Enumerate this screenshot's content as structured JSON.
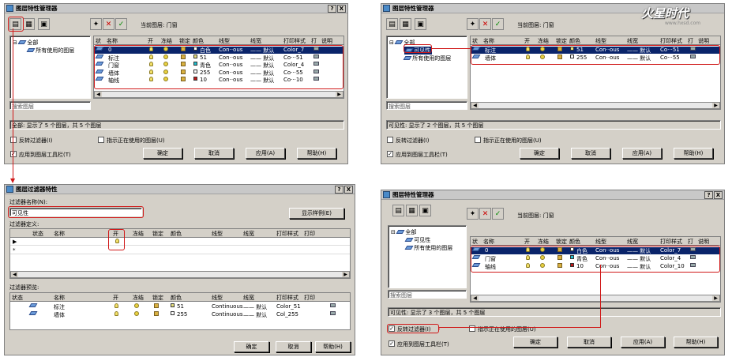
{
  "common": {
    "title": "图层特性管理器",
    "help_btn": "?",
    "close_btn": "X",
    "all_node": "全部",
    "used_node": "所有使用的图层",
    "search_placeholder": "搜索图层",
    "invert_filter": "反转过滤器(I)",
    "indicate_used": "指示正在使用的图层(U)",
    "apply_toolbar": "应用到图层工具栏(T)",
    "ok": "确定",
    "cancel": "取消",
    "apply": "应用(A)",
    "help": "帮助(H)",
    "columns": [
      "状",
      "名称",
      "开",
      "冻结",
      "锁定",
      "颜色",
      "线型",
      "线宽",
      "打印样式",
      "打",
      "说明"
    ]
  },
  "dialog1": {
    "current_layer": "当前图层: 门窗",
    "status": "全部: 显示了 5 个图层，共 5 个图层",
    "rows": [
      {
        "name": "0",
        "color_name": "白色",
        "color": "#ffffff",
        "linetype": "Con··ous",
        "lineweight": "—— 默认",
        "plot": "Color_7"
      },
      {
        "name": "标注",
        "color_name": "51",
        "color": "#e8e080",
        "linetype": "Con··ous",
        "lineweight": "—— 默认",
        "plot": "Co···51"
      },
      {
        "name": "门窗",
        "color_name": "青色",
        "color": "#20c0d0",
        "linetype": "Con··ous",
        "lineweight": "—— 默认",
        "plot": "Color_4"
      },
      {
        "name": "墙体",
        "color_name": "255",
        "color": "#ffffff",
        "linetype": "Con··ous",
        "lineweight": "—— 默认",
        "plot": "Co···55"
      },
      {
        "name": "轴线",
        "color_name": "10",
        "color": "#c01818",
        "linetype": "Con··ous",
        "lineweight": "—— 默认",
        "plot": "Co···10"
      }
    ]
  },
  "dialog2": {
    "current_layer": "当前图层: 门窗",
    "filter_node": "可见性",
    "status": "可见性: 显示了 2 个图层，共 5 个图层",
    "rows": [
      {
        "name": "标注",
        "color_name": "51",
        "color": "#e8e080",
        "linetype": "Con··ous",
        "lineweight": "—— 默认",
        "plot": "Co···51"
      },
      {
        "name": "墙体",
        "color_name": "255",
        "color": "#ffffff",
        "linetype": "Con··ous",
        "lineweight": "—— 默认",
        "plot": "Co···55"
      }
    ]
  },
  "dialog3": {
    "title": "图层过滤器特性",
    "filter_name_label": "过滤器名称(N):",
    "filter_name_value": "可见性",
    "show_example": "显示样例(E)",
    "filter_def_label": "过滤器定义:",
    "def_columns": [
      "状态",
      "名称",
      "开",
      "冻结",
      "锁定",
      "颜色",
      "线型",
      "线宽",
      "打印样式",
      "打印"
    ],
    "preview_label": "过滤器预览:",
    "preview_columns": [
      "状态",
      "名称",
      "开",
      "冻结",
      "锁定",
      "颜色",
      "线型",
      "线宽",
      "打印样式",
      "打印"
    ],
    "preview_rows": [
      {
        "name": "标注",
        "color_name": "51",
        "color": "#e8e080",
        "linetype": "Continuous",
        "lineweight": "—— 默认",
        "plot": "Color_51"
      },
      {
        "name": "墙体",
        "color_name": "255",
        "color": "#ffffff",
        "linetype": "Continuous",
        "lineweight": "—— 默认",
        "plot": "Col_255"
      }
    ]
  },
  "dialog4": {
    "current_layer": "当前图层: 门窗",
    "filter_node": "可见性",
    "status": "可见性: 显示了 3 个图层，共 5 个图层",
    "rows": [
      {
        "name": "0",
        "color_name": "白色",
        "color": "#ffffff",
        "linetype": "Con··ous",
        "lineweight": "—— 默认",
        "plot": "Color_7"
      },
      {
        "name": "门窗",
        "color_name": "青色",
        "color": "#20c0d0",
        "linetype": "Con··ous",
        "lineweight": "—— 默认",
        "plot": "Color_4"
      },
      {
        "name": "轴线",
        "color_name": "10",
        "color": "#c01818",
        "linetype": "Con··ous",
        "lineweight": "—— 默认",
        "plot": "Color_10"
      }
    ]
  },
  "watermark": {
    "brand": "火星时代",
    "url": "www.hxsd.com"
  }
}
